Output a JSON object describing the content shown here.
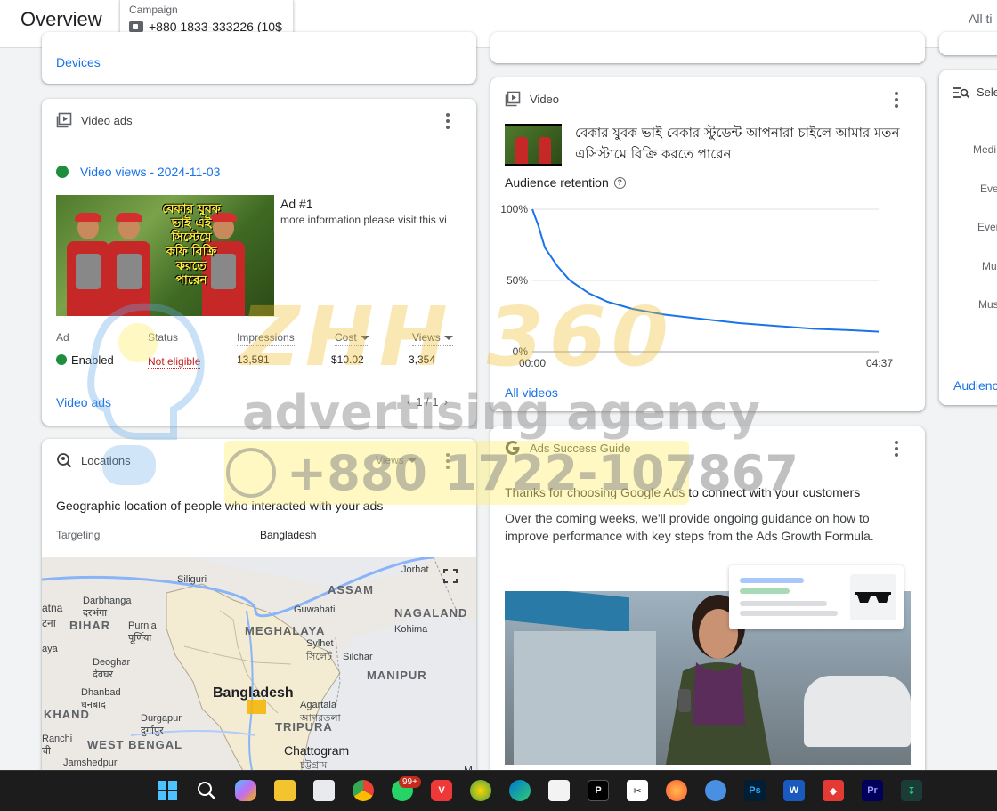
{
  "header": {
    "title": "Overview",
    "campaign_label": "Campaign",
    "campaign_value": "+880 1833-333226 (10$",
    "date_range": "All ti"
  },
  "devices_card": {
    "link": "Devices"
  },
  "video_ads_card": {
    "title": "Video ads",
    "video_views_label": "Video views - 2024-11-03",
    "thumb_caption": "বেকার যুবক ভাই এই সিস্টেমে কফি বিক্রি করতে পারেন",
    "ad_title": "Ad #1",
    "ad_desc": "more information please visit this vi",
    "columns": {
      "ad": "Ad",
      "status": "Status",
      "impressions": "Impressions",
      "cost": "Cost",
      "views": "Views"
    },
    "row": {
      "ad": "Enabled",
      "status": "Not eligible",
      "impressions": "13,591",
      "cost": "$10.02",
      "views": "3,354"
    },
    "footer_link": "Video ads",
    "pager": "1 / 1"
  },
  "locations_card": {
    "title": "Locations",
    "views_select": "Views",
    "geo_title": "Geographic location of people who interacted with your ads",
    "targeting_label": "Targeting",
    "targeting_value": "Bangladesh",
    "map_labels": {
      "siliguri": "Siliguri",
      "jorhat": "Jorhat",
      "assam": "ASSAM",
      "darbhanga": "Darbhanga",
      "darbhanga_bn": "दरभंगा",
      "bihar": "BIHAR",
      "atna": "atna",
      "atna_bn": "टना",
      "purnia": "Purnia",
      "purnia_bn": "पूर्णिया",
      "guwahati": "Guwahati",
      "nagaland": "NAGALAND",
      "meghalaya": "MEGHALAYA",
      "kohima": "Kohima",
      "sylhet": "Sylhet",
      "sylhet_bn": "সিলেট",
      "silchar": "Silchar",
      "aya": "aya",
      "deoghar": "Deoghar",
      "deoghar_bn": "देवघर",
      "manipur": "MANIPUR",
      "dhanbad": "Dhanbad",
      "dhanbad_bn": "धनबाद",
      "bangladesh": "Bangladesh",
      "khand": "KHAND",
      "durgapur": "Durgapur",
      "durgapur_bn": "दुर्गापुर",
      "agartala": "Agartala",
      "agartala_bn": "আগরতলা",
      "tripura": "TRIPURA",
      "ranchi": "Ranchi",
      "ranchi_bn": "ची",
      "west_bengal": "WEST BENGAL",
      "chattogram": "Chattogram",
      "chattogram_bn": "চট্টগ্রাম",
      "jamshedpur": "Jamshedpur",
      "m": "M"
    }
  },
  "video_card": {
    "title": "Video",
    "video_title": "বেকার যুবক ভাই বেকার স্টুডেন্ট আপনারা চাইলে আমার মতন এসিস্টামে বিক্রি করতে পারেন",
    "retention_title": "Audience retention",
    "footer_link": "All videos"
  },
  "chart_data": {
    "type": "line",
    "title": "Audience retention",
    "x": [
      "00:00",
      "00:05",
      "00:10",
      "00:20",
      "00:30",
      "00:45",
      "01:00",
      "01:20",
      "01:45",
      "02:15",
      "02:45",
      "03:15",
      "03:45",
      "04:15",
      "04:37"
    ],
    "series": [
      {
        "values": [
          100,
          88,
          73,
          60,
          50,
          41,
          35,
          30,
          26,
          23,
          20,
          18,
          16,
          15,
          14
        ]
      }
    ],
    "x_ticks": [
      "00:00",
      "04:37"
    ],
    "y_ticks": [
      "100%",
      "50%",
      "0%"
    ],
    "ylim": [
      0,
      100
    ],
    "grid": true
  },
  "guide_card": {
    "title": "Ads Success Guide",
    "heading": "Thanks for choosing Google Ads to connect with your customers",
    "body": "Over the coming weeks, we'll provide ongoing guidance on how to improve performance with key steps from the Ads Growth Formula."
  },
  "select_card": {
    "title": "Sele",
    "items": [
      "Medi",
      "Eve",
      "Ever",
      "Mu",
      "Mus"
    ],
    "link": "Audienc"
  },
  "watermark": {
    "brand": "ZHH 360",
    "tagline": "advertising agency",
    "phone": "+880 1722-107867"
  },
  "taskbar": {
    "badge": "99+"
  },
  "colors": {
    "accent": "#1a73e8",
    "enabled": "#1e8e3e",
    "error": "#c5221f",
    "chart_line": "#1a73e8"
  }
}
